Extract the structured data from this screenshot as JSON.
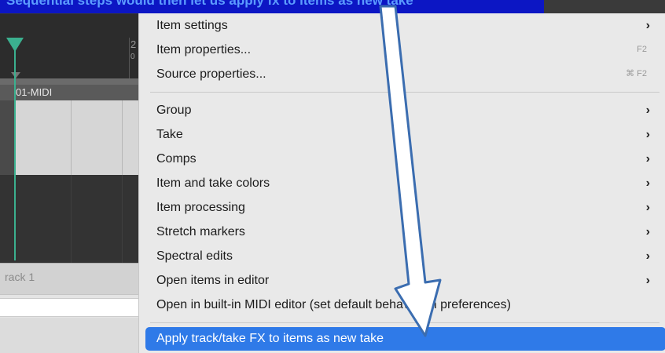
{
  "caption": "Sequential steps would then let us apply fx to items as new take",
  "arrange": {
    "ruler_number": "2",
    "ruler_sub": "0",
    "item_name": "01-MIDI",
    "track_name": "rack 1"
  },
  "menu": {
    "items": [
      {
        "label": "Item settings",
        "submenu": true
      },
      {
        "label": "Item properties...",
        "shortcut": "F2"
      },
      {
        "label": "Source properties...",
        "shortcut": "⌘ F2"
      },
      {
        "label": "Group",
        "submenu": true
      },
      {
        "label": "Take",
        "submenu": true
      },
      {
        "label": "Comps",
        "submenu": true
      },
      {
        "label": "Item and take colors",
        "submenu": true
      },
      {
        "label": "Item processing",
        "submenu": true
      },
      {
        "label": "Stretch markers",
        "submenu": true
      },
      {
        "label": "Spectral edits",
        "submenu": true
      },
      {
        "label": "Open items in editor",
        "submenu": true
      },
      {
        "label": "Open in built-in MIDI editor (set default behavior in preferences)"
      }
    ],
    "chevron": "›",
    "highlighted": "Apply track/take FX to items as new take"
  },
  "colors": {
    "highlight": "#2f7ae8",
    "arrow_fill": "#ffffff",
    "arrow_stroke": "#3b6db0",
    "playhead": "#3bb08f",
    "caption_bg": "#0c16c4"
  },
  "icons": [
    "chevron-right-icon",
    "down-arrow-annotation"
  ]
}
